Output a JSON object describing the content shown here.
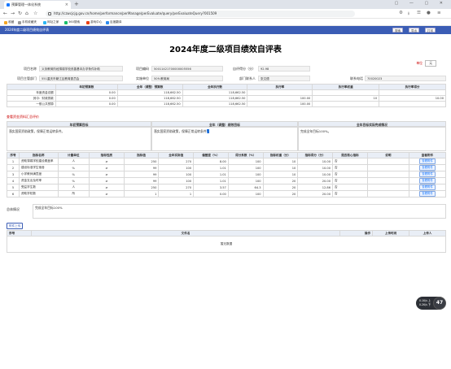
{
  "browser": {
    "tab_title": "预算管理一体化系统",
    "url": "http://czwcjcjg.gov.cn/home/performance/perManage/perEvaluate/query/perEvaluateQuery?001509",
    "bookmarks": [
      "收藏",
      "手机收藏夹",
      "网址之家",
      "360搜索",
      "游戏中心",
      "百度翻译"
    ]
  },
  "app": {
    "breadcrumb": "2024年度二级项目绩效自评表",
    "btn_search": "搜索",
    "btn_export": "导出",
    "btn_print": "打印"
  },
  "page": {
    "title": "2024年度二级项目绩效自评表",
    "unit_label": "单位",
    "unit_value": "元"
  },
  "info": {
    "project_name_label": "项目名称",
    "project_name": "义务教育阶段薄弱学校改善基本办学条件补助",
    "project_code_label": "项目编码",
    "project_code": "50011421700000005556",
    "self_score_label": "自评得分（分）",
    "self_score": "92.98",
    "dept_label": "项目主管部门",
    "dept": "551重庆市綦江区教育委员会",
    "impl_label": "实施单位",
    "impl": "509-教育局",
    "contact_label": "部门联系人",
    "contact": "张文德",
    "phone_label": "联系电话",
    "phone": "70020023"
  },
  "funds": {
    "headers": [
      "",
      "年初预算数",
      "全年（调整）预算数",
      "全年执行数",
      "执行率",
      "执行率权重",
      "执行率得分"
    ],
    "rows": [
      [
        "年度资金总额",
        "0.00",
        "118,662.50",
        "118,662.50",
        "",
        "",
        ""
      ],
      [
        "其中：财政拨款",
        "0.00",
        "118,662.50",
        "118,662.50",
        "100.00",
        "10",
        "10.00"
      ],
      [
        "一般公共预算",
        "0.00",
        "118,662.50",
        "118,662.50",
        "100.00",
        "",
        ""
      ]
    ]
  },
  "goals": {
    "section_title": "查看资金资料汇总评价",
    "annual_header": "年初预算目标",
    "adjusted_header": "全年（调整）绩效目标",
    "achieved_header": "全年目标实际完成情况",
    "annual_text": "落实国家资助政策，保障正常运转条件。",
    "adjusted_text_a": "落实国家资助政策，保障正常运转条件",
    "adjusted_text_b": "。",
    "achieved_text": "完成全年目标100%。"
  },
  "indicators": {
    "headers": [
      "序号",
      "指标名称",
      "计量单位",
      "指标性质",
      "指标值",
      "全年实际值",
      "偏差度（%）",
      "得分系数（%）",
      "指标权重（分）",
      "指标得分（分）",
      "是否核心指标",
      "说明",
      "查看附件"
    ],
    "rows": [
      [
        "1",
        "资助薄弱学校建设覆盖率",
        "人",
        "≥",
        "250",
        "270",
        "8.00",
        "100",
        "10",
        "10.00",
        "否",
        "",
        "查看附件"
      ],
      [
        "2",
        "建设标准学生宿舍",
        "%",
        "≥",
        "99",
        "100",
        "1.01",
        "100",
        "10",
        "10.00",
        "否",
        "",
        "查看附件"
      ],
      [
        "3",
        "小学教师满意度",
        "%",
        "≥",
        "99",
        "100",
        "1.01",
        "100",
        "10",
        "10.00",
        "否",
        "",
        "查看附件"
      ],
      [
        "4",
        "资金支出及时率",
        "%",
        "≥",
        "99",
        "100",
        "1.01",
        "100",
        "20",
        "20.00",
        "否",
        "",
        "查看附件"
      ],
      [
        "5",
        "受益学生数",
        "人",
        "≥",
        "250",
        "270",
        "3.57",
        "64.3",
        "20",
        "12.86",
        "否",
        "",
        "查看附件"
      ],
      [
        "6",
        "资助学校数",
        "所",
        "≥",
        "1",
        "1",
        "0.00",
        "100",
        "20",
        "20.00",
        "否",
        "",
        "查看附件"
      ]
    ]
  },
  "summary": {
    "label": "总体情况",
    "text": "完成全年目标100%"
  },
  "attachments": {
    "upload_label": "附件上传",
    "headers": [
      "序号",
      "文件名",
      "操作",
      "上传时间",
      "上传人"
    ],
    "empty_text": "暂无数据"
  },
  "widget": {
    "line1": "0.1K/s 上",
    "line2": "0.2K/s 下",
    "value": "47"
  }
}
